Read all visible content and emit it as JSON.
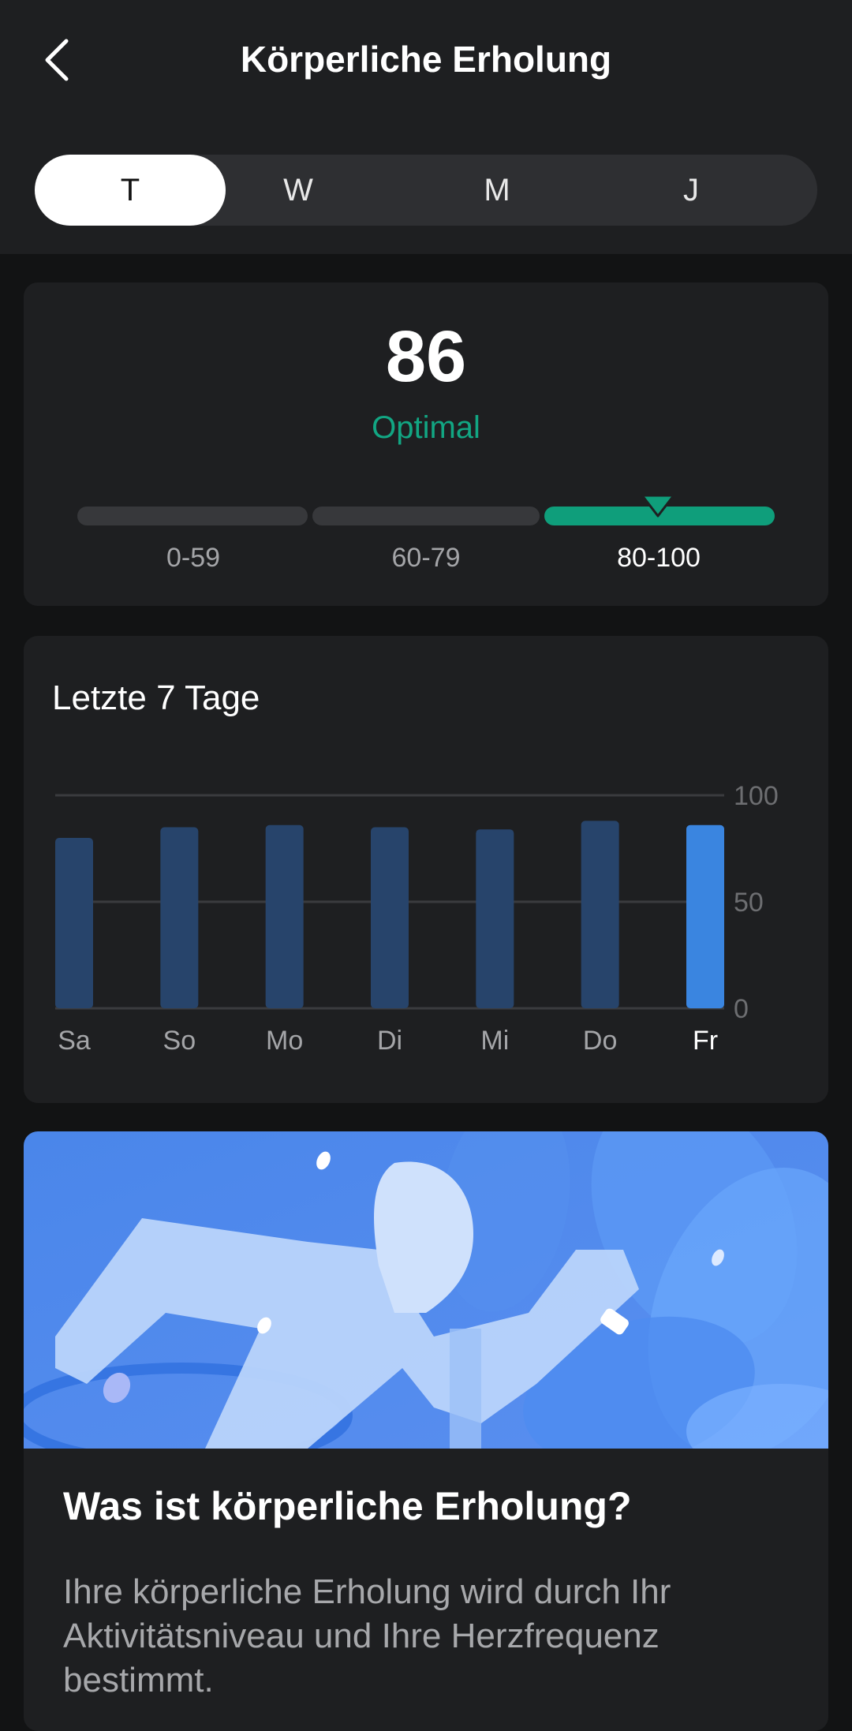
{
  "header": {
    "title": "Körperliche Erholung",
    "back_icon": "chevron-left-icon"
  },
  "period_tabs": [
    {
      "label": "T",
      "active": true
    },
    {
      "label": "W",
      "active": false
    },
    {
      "label": "M",
      "active": false
    },
    {
      "label": "J",
      "active": false
    }
  ],
  "score": {
    "value": "86",
    "status": "Optimal",
    "ranges": [
      {
        "label": "0-59",
        "active": false
      },
      {
        "label": "60-79",
        "active": false
      },
      {
        "label": "80-100",
        "active": true
      }
    ],
    "colors": {
      "optimal": "#12a683",
      "inactive": "#37383b"
    }
  },
  "chart_data": {
    "type": "bar",
    "title": "Letzte 7 Tage",
    "categories": [
      "Sa",
      "So",
      "Mo",
      "Di",
      "Mi",
      "Do",
      "Fr"
    ],
    "values": [
      80,
      85,
      86,
      85,
      84,
      88,
      86
    ],
    "ylim": [
      0,
      100
    ],
    "yticks": [
      "100",
      "50",
      "0"
    ],
    "highlight_index": 6,
    "colors": {
      "bar": "#27446b",
      "highlight": "#3a85e0",
      "grid": "#3a3b3e"
    }
  },
  "info": {
    "title": "Was ist körperliche Erholung?",
    "body": "Ihre körperliche Erholung wird durch Ihr Aktivitätsniveau und Ihre Herzfrequenz bestimmt."
  }
}
